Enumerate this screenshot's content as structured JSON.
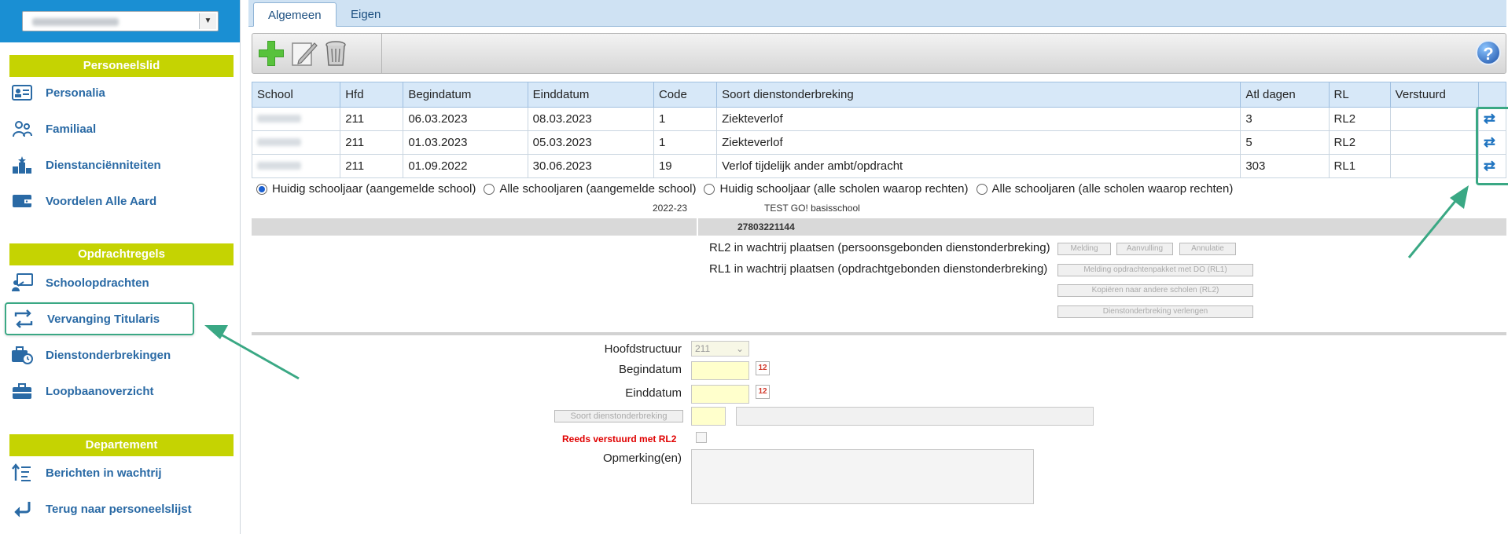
{
  "sidebar": {
    "school_select": {
      "value": "",
      "dropdown_glyph": "▼"
    },
    "sections": [
      {
        "title": "Personeelslid"
      },
      {
        "title": "Opdrachtregels"
      },
      {
        "title": "Departement"
      }
    ],
    "items": [
      {
        "label": "Personalia",
        "icon": "id-card-icon"
      },
      {
        "label": "Familiaal",
        "icon": "family-icon"
      },
      {
        "label": "Dienstanciënniteiten",
        "icon": "podium-icon"
      },
      {
        "label": "Voordelen Alle Aard",
        "icon": "wallet-icon"
      },
      {
        "label": "Schoolopdrachten",
        "icon": "teacher-board-icon"
      },
      {
        "label": "Vervanging Titularis",
        "icon": "swap-arrows-icon"
      },
      {
        "label": "Dienstonderbrekingen",
        "icon": "briefcase-clock-icon"
      },
      {
        "label": "Loopbaanoverzicht",
        "icon": "briefcase-icon"
      },
      {
        "label": "Berichten in wachtrij",
        "icon": "sort-list-icon"
      },
      {
        "label": "Terug naar personeelslijst",
        "icon": "return-arrow-icon"
      }
    ]
  },
  "tabs": [
    {
      "label": "Algemeen"
    },
    {
      "label": "Eigen"
    }
  ],
  "toolbar": {
    "add": "add-icon",
    "edit": "edit-icon",
    "delete": "delete-icon",
    "help_label": "?"
  },
  "table": {
    "headers": [
      "School",
      "Hfd",
      "Begindatum",
      "Einddatum",
      "Code",
      "Soort dienstonderbreking",
      "Atl dagen",
      "RL",
      "Verstuurd",
      ""
    ],
    "rows": [
      {
        "school": "",
        "hfd": "211",
        "begin": "06.03.2023",
        "eind": "08.03.2023",
        "code": "1",
        "soort": "Ziekteverlof",
        "atl": "3",
        "rl": "RL2",
        "verstuurd": ""
      },
      {
        "school": "",
        "hfd": "211",
        "begin": "01.03.2023",
        "eind": "05.03.2023",
        "code": "1",
        "soort": "Ziekteverlof",
        "atl": "5",
        "rl": "RL2",
        "verstuurd": ""
      },
      {
        "school": "",
        "hfd": "211",
        "begin": "01.09.2022",
        "eind": "30.06.2023",
        "code": "19",
        "soort": "Verlof tijdelijk ander ambt/opdracht",
        "atl": "303",
        "rl": "RL1",
        "verstuurd": ""
      }
    ],
    "row_action_glyph": "⇄"
  },
  "filters": {
    "options": [
      {
        "label": "Huidig schooljaar (aangemelde school)",
        "checked": true
      },
      {
        "label": "Alle schooljaren (aangemelde school)",
        "checked": false
      },
      {
        "label": "Huidig schooljaar (alle scholen waarop rechten)",
        "checked": false
      },
      {
        "label": "Alle schooljaren (alle scholen waarop rechten)",
        "checked": false
      }
    ]
  },
  "info": {
    "schoolyear": "2022-23",
    "school_name": "TEST GO! basisschool",
    "number": "27803221144"
  },
  "queue": {
    "rl2_text": "RL2 in wachtrij plaatsen (persoonsgebonden dienstonderbreking)",
    "rl1_text": "RL1 in wachtrij plaatsen (opdrachtgebonden dienstonderbreking)",
    "btn_melding": "Melding",
    "btn_aanvulling": "Aanvulling",
    "btn_annulatie": "Annulatie",
    "btn_melding_pakket": "Melding opdrachtenpakket met DO (RL1)",
    "btn_kopieren": "Kopiëren naar andere scholen (RL2)",
    "btn_verlengen": "Dienstonderbreking verlengen"
  },
  "form": {
    "hoofdstructuur_label": "Hoofdstructuur",
    "hoofdstructuur_value": "211",
    "begindatum_label": "Begindatum",
    "einddatum_label": "Einddatum",
    "soort_button": "Soort dienstonderbreking",
    "reeds_label": "Reeds verstuurd met RL2",
    "opmerking_label": "Opmerking(en)",
    "calendar_glyph": "12"
  },
  "colors": {
    "accent_green": "#c5d302",
    "link_blue": "#2a6aa5",
    "highlight": "#3aa884",
    "header_blue": "#1a8fd3"
  }
}
